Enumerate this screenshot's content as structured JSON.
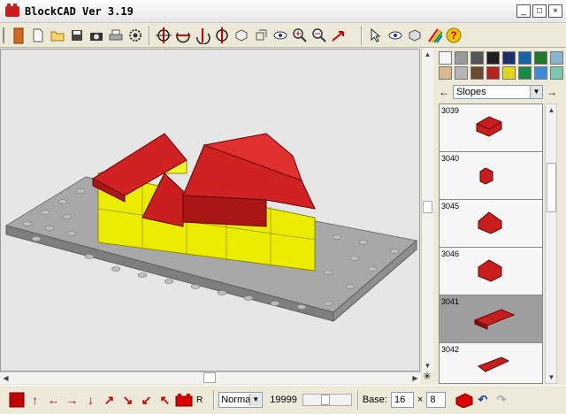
{
  "window": {
    "title": "BlockCAD Ver 3.19",
    "buttons": [
      "_",
      "□",
      "×"
    ]
  },
  "palette": [
    "#f4f4f4",
    "#9a9a9a",
    "#555555",
    "#1f1f1f",
    "#1c2f6a",
    "#1664a8",
    "#1e7a28",
    "#8ab3cf",
    "#d9b98c",
    "#b6b6b6",
    "#6a4a2a",
    "#b82020",
    "#e2d61a",
    "#1a8a4a",
    "#3c8ad8",
    "#7ec8b0"
  ],
  "category": "Slopes",
  "parts": [
    {
      "id": "3039"
    },
    {
      "id": "3040"
    },
    {
      "id": "3045"
    },
    {
      "id": "3046"
    },
    {
      "id": "3041",
      "selected": true
    },
    {
      "id": "3042"
    }
  ],
  "bottom": {
    "mode": "Norma",
    "count": "19999",
    "base_label": "Base:",
    "base_x": "16",
    "times": "×",
    "base_y": "8",
    "r_label": "R"
  },
  "colors": {
    "brick_red": "#c81e1e",
    "plate_gray": "#a8a8a8",
    "brick_yellow": "#f0e614"
  }
}
